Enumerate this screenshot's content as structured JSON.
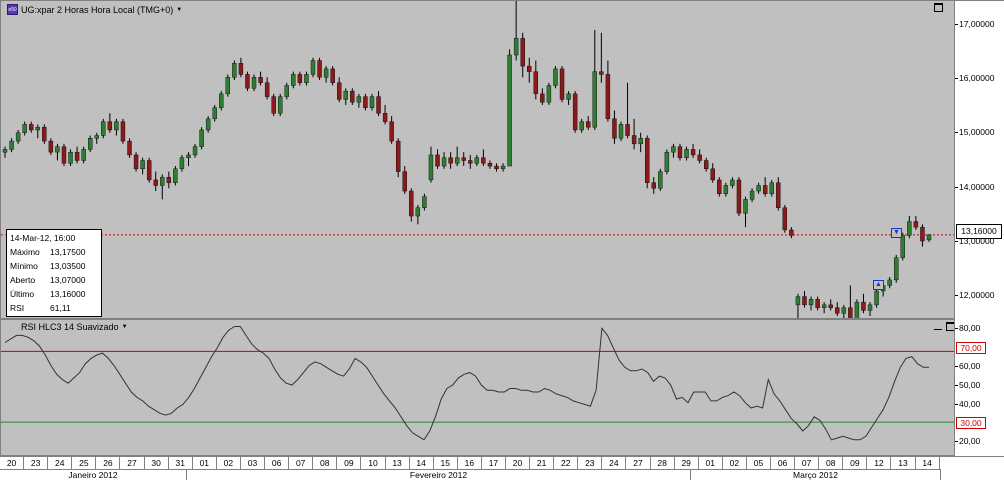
{
  "chart": {
    "title": "UG:xpar 2 Horas Hora Local (TMG+0)",
    "logo_text": "e50",
    "last_price_label": "13,16000",
    "colors": {
      "up": "#2e7d32",
      "down": "#8b1a1a",
      "wick": "#000000",
      "last_line": "#cc0000",
      "rsi_line": "#333333",
      "overbought_line": "#cc0000",
      "oversold_line": "#228b22"
    }
  },
  "info_box": {
    "header": "14-Mar-12, 16:00",
    "rows": [
      {
        "key": "Máximo",
        "value": "13,17500"
      },
      {
        "key": "Mínimo",
        "value": "13,03500"
      },
      {
        "key": "Aberto",
        "value": "13,07000"
      },
      {
        "key": "Último",
        "value": "13,16000"
      },
      {
        "key": "RSI",
        "value": "61,11"
      }
    ]
  },
  "price_axis": {
    "ticks": [
      "17,00000",
      "16,00000",
      "15,00000",
      "14,00000",
      "13,00000",
      "12,00000"
    ]
  },
  "rsi_pane": {
    "title": "RSI HLC3  14 Suavizado",
    "ticks": [
      "80,00",
      "70,00",
      "60,00",
      "50,00",
      "40,00",
      "30,00",
      "20,00"
    ],
    "overbought": "70,00",
    "oversold": "30,00"
  },
  "date_axis": {
    "days": [
      "20",
      "23",
      "24",
      "25",
      "26",
      "27",
      "30",
      "31",
      "01",
      "02",
      "03",
      "06",
      "07",
      "08",
      "09",
      "10",
      "13",
      "14",
      "15",
      "16",
      "17",
      "20",
      "21",
      "22",
      "23",
      "24",
      "27",
      "28",
      "29",
      "01",
      "02",
      "05",
      "06",
      "07",
      "08",
      "09",
      "12",
      "13",
      "14"
    ],
    "months": [
      "Janeiro 2012",
      "Fevereiro 2012",
      "Março 2012"
    ]
  },
  "chart_data": {
    "type": "candlestick",
    "y_range": [
      11.7,
      17.3
    ],
    "candles": [
      [
        14.65,
        14.75,
        14.55,
        14.7
      ],
      [
        14.7,
        14.9,
        14.65,
        14.85
      ],
      [
        14.85,
        15.05,
        14.8,
        15.0
      ],
      [
        15.0,
        15.2,
        14.95,
        15.15
      ],
      [
        15.15,
        15.2,
        15.0,
        15.05
      ],
      [
        15.05,
        15.15,
        14.9,
        15.1
      ],
      [
        15.1,
        15.15,
        14.8,
        14.85
      ],
      [
        14.85,
        14.9,
        14.6,
        14.65
      ],
      [
        14.65,
        14.8,
        14.5,
        14.75
      ],
      [
        14.75,
        14.8,
        14.4,
        14.45
      ],
      [
        14.45,
        14.7,
        14.4,
        14.65
      ],
      [
        14.65,
        14.75,
        14.45,
        14.5
      ],
      [
        14.5,
        14.75,
        14.45,
        14.7
      ],
      [
        14.7,
        14.95,
        14.65,
        14.9
      ],
      [
        14.9,
        15.0,
        14.8,
        14.95
      ],
      [
        14.95,
        15.25,
        14.9,
        15.2
      ],
      [
        15.2,
        15.35,
        15.0,
        15.05
      ],
      [
        15.05,
        15.25,
        14.95,
        15.2
      ],
      [
        15.2,
        15.25,
        14.8,
        14.85
      ],
      [
        14.85,
        14.9,
        14.55,
        14.6
      ],
      [
        14.6,
        14.65,
        14.3,
        14.35
      ],
      [
        14.35,
        14.55,
        14.25,
        14.5
      ],
      [
        14.5,
        14.55,
        14.1,
        14.15
      ],
      [
        14.15,
        14.3,
        13.95,
        14.05
      ],
      [
        14.05,
        14.25,
        13.8,
        14.2
      ],
      [
        14.2,
        14.3,
        14.0,
        14.1
      ],
      [
        14.1,
        14.4,
        14.05,
        14.35
      ],
      [
        14.35,
        14.6,
        14.3,
        14.55
      ],
      [
        14.55,
        14.65,
        14.4,
        14.6
      ],
      [
        14.6,
        14.8,
        14.55,
        14.75
      ],
      [
        14.75,
        15.1,
        14.7,
        15.05
      ],
      [
        15.05,
        15.3,
        15.0,
        15.25
      ],
      [
        15.25,
        15.5,
        15.2,
        15.45
      ],
      [
        15.45,
        15.75,
        15.4,
        15.7
      ],
      [
        15.7,
        16.05,
        15.65,
        16.0
      ],
      [
        16.0,
        16.3,
        15.95,
        16.25
      ],
      [
        16.25,
        16.35,
        16.0,
        16.05
      ],
      [
        16.05,
        16.1,
        15.75,
        15.8
      ],
      [
        15.8,
        16.05,
        15.75,
        16.0
      ],
      [
        16.0,
        16.1,
        15.85,
        15.9
      ],
      [
        15.9,
        16.0,
        15.6,
        15.65
      ],
      [
        15.65,
        15.7,
        15.3,
        15.35
      ],
      [
        15.35,
        15.7,
        15.3,
        15.65
      ],
      [
        15.65,
        15.9,
        15.6,
        15.85
      ],
      [
        15.85,
        16.1,
        15.8,
        16.05
      ],
      [
        16.05,
        16.1,
        15.85,
        15.9
      ],
      [
        15.9,
        16.1,
        15.85,
        16.05
      ],
      [
        16.05,
        16.35,
        16.0,
        16.3
      ],
      [
        16.3,
        16.35,
        15.95,
        16.0
      ],
      [
        16.0,
        16.2,
        15.9,
        16.15
      ],
      [
        16.15,
        16.2,
        15.85,
        15.9
      ],
      [
        15.9,
        16.0,
        15.55,
        15.6
      ],
      [
        15.6,
        15.8,
        15.5,
        15.75
      ],
      [
        15.75,
        15.8,
        15.5,
        15.55
      ],
      [
        15.55,
        15.7,
        15.45,
        15.65
      ],
      [
        15.65,
        15.7,
        15.4,
        15.45
      ],
      [
        15.45,
        15.7,
        15.4,
        15.65
      ],
      [
        15.65,
        15.75,
        15.3,
        15.35
      ],
      [
        15.35,
        15.5,
        15.15,
        15.2
      ],
      [
        15.2,
        15.3,
        14.8,
        14.85
      ],
      [
        14.85,
        14.9,
        14.2,
        14.3
      ],
      [
        14.3,
        14.4,
        13.9,
        13.95
      ],
      [
        13.95,
        14.0,
        13.4,
        13.5
      ],
      [
        13.5,
        13.7,
        13.35,
        13.65
      ],
      [
        13.65,
        13.9,
        13.6,
        13.85
      ],
      [
        14.15,
        14.75,
        14.1,
        14.6
      ],
      [
        14.6,
        14.7,
        14.35,
        14.4
      ],
      [
        14.4,
        14.65,
        14.35,
        14.55
      ],
      [
        14.55,
        14.65,
        14.35,
        14.45
      ],
      [
        14.45,
        14.75,
        14.4,
        14.55
      ],
      [
        14.55,
        14.65,
        14.4,
        14.5
      ],
      [
        14.5,
        14.6,
        14.35,
        14.45
      ],
      [
        14.45,
        14.6,
        14.4,
        14.55
      ],
      [
        14.55,
        14.7,
        14.4,
        14.45
      ],
      [
        14.45,
        14.5,
        14.35,
        14.4
      ],
      [
        14.4,
        14.45,
        14.3,
        14.35
      ],
      [
        14.35,
        14.45,
        14.3,
        14.4
      ],
      [
        14.4,
        16.5,
        15.3,
        16.4
      ],
      [
        16.4,
        17.4,
        16.3,
        16.7
      ],
      [
        16.7,
        16.8,
        16.0,
        16.2
      ],
      [
        16.2,
        16.35,
        15.9,
        16.1
      ],
      [
        16.1,
        16.3,
        15.6,
        15.7
      ],
      [
        15.7,
        15.8,
        15.5,
        15.55
      ],
      [
        15.55,
        15.9,
        15.5,
        15.85
      ],
      [
        15.85,
        16.2,
        15.8,
        16.15
      ],
      [
        16.15,
        16.2,
        15.55,
        15.6
      ],
      [
        15.6,
        15.75,
        15.5,
        15.7
      ],
      [
        15.7,
        15.75,
        15.0,
        15.05
      ],
      [
        15.05,
        15.25,
        15.0,
        15.2
      ],
      [
        15.2,
        15.3,
        15.05,
        15.1
      ],
      [
        15.1,
        16.85,
        15.05,
        16.1
      ],
      [
        16.1,
        16.8,
        15.9,
        16.05
      ],
      [
        16.05,
        16.3,
        15.2,
        15.25
      ],
      [
        15.25,
        15.4,
        14.8,
        14.9
      ],
      [
        14.9,
        15.2,
        14.85,
        15.15
      ],
      [
        15.15,
        15.9,
        14.9,
        14.95
      ],
      [
        14.95,
        15.25,
        14.7,
        14.8
      ],
      [
        14.8,
        15.0,
        14.65,
        14.9
      ],
      [
        14.9,
        14.95,
        14.0,
        14.1
      ],
      [
        14.1,
        14.2,
        13.9,
        14.0
      ],
      [
        14.0,
        14.35,
        13.95,
        14.3
      ],
      [
        14.3,
        14.7,
        14.25,
        14.65
      ],
      [
        14.65,
        14.8,
        14.55,
        14.75
      ],
      [
        14.75,
        14.8,
        14.5,
        14.55
      ],
      [
        14.55,
        14.75,
        14.5,
        14.7
      ],
      [
        14.7,
        14.8,
        14.55,
        14.6
      ],
      [
        14.6,
        14.7,
        14.45,
        14.5
      ],
      [
        14.5,
        14.55,
        14.3,
        14.35
      ],
      [
        14.35,
        14.45,
        14.1,
        14.15
      ],
      [
        14.15,
        14.2,
        13.85,
        13.9
      ],
      [
        13.9,
        14.1,
        13.85,
        14.05
      ],
      [
        14.05,
        14.2,
        14.0,
        14.15
      ],
      [
        14.15,
        14.2,
        13.5,
        13.55
      ],
      [
        13.55,
        13.85,
        13.3,
        13.8
      ],
      [
        13.8,
        14.0,
        13.75,
        13.95
      ],
      [
        13.95,
        14.1,
        13.9,
        14.05
      ],
      [
        14.05,
        14.2,
        13.85,
        13.9
      ],
      [
        13.9,
        14.15,
        13.85,
        14.1
      ],
      [
        14.1,
        14.2,
        13.6,
        13.65
      ],
      [
        13.65,
        13.7,
        13.2,
        13.25
      ],
      [
        13.25,
        13.3,
        13.1,
        13.15
      ],
      [
        11.9,
        12.1,
        11.6,
        12.05
      ],
      [
        12.05,
        12.15,
        11.85,
        11.9
      ],
      [
        11.9,
        12.05,
        11.8,
        12.0
      ],
      [
        12.0,
        12.05,
        11.8,
        11.85
      ],
      [
        11.85,
        11.95,
        11.75,
        11.9
      ],
      [
        11.9,
        12.0,
        11.8,
        11.85
      ],
      [
        11.85,
        11.95,
        11.7,
        11.75
      ],
      [
        11.75,
        11.9,
        11.65,
        11.85
      ],
      [
        11.85,
        12.25,
        11.55,
        11.6
      ],
      [
        11.6,
        12.0,
        11.5,
        11.95
      ],
      [
        11.95,
        12.1,
        11.75,
        11.8
      ],
      [
        11.8,
        11.95,
        11.7,
        11.9
      ],
      [
        11.9,
        12.2,
        11.85,
        12.15
      ],
      [
        12.15,
        12.3,
        12.05,
        12.25
      ],
      [
        12.25,
        12.4,
        12.2,
        12.35
      ],
      [
        12.35,
        12.8,
        12.3,
        12.75
      ],
      [
        12.75,
        13.2,
        12.7,
        13.15
      ],
      [
        13.15,
        13.5,
        13.1,
        13.4
      ],
      [
        13.4,
        13.5,
        13.25,
        13.3
      ],
      [
        13.3,
        13.35,
        12.95,
        13.05
      ],
      [
        13.07,
        13.175,
        13.035,
        13.16
      ]
    ],
    "last": 13.16,
    "rsi": [
      75,
      77,
      79,
      79,
      78,
      76,
      73,
      68,
      62,
      57,
      54,
      52,
      55,
      58,
      63,
      66,
      68,
      69,
      66,
      62,
      57,
      52,
      47,
      44,
      42,
      39,
      37,
      35,
      34,
      35,
      38,
      40,
      44,
      49,
      55,
      61,
      67,
      72,
      78,
      82,
      84,
      84,
      79,
      74,
      71,
      69,
      66,
      60,
      55,
      52,
      51,
      54,
      58,
      62,
      64,
      63,
      61,
      59,
      57,
      56,
      60,
      66,
      64,
      61,
      56,
      51,
      46,
      42,
      38,
      33,
      28,
      24,
      22,
      20,
      25,
      33,
      43,
      49,
      51,
      55,
      57,
      58,
      56,
      51,
      48,
      48,
      47,
      47,
      49,
      49,
      48,
      48,
      47,
      47,
      49,
      48,
      46,
      45,
      44,
      42,
      41,
      40,
      39,
      48,
      83,
      79,
      72,
      65,
      61,
      59,
      59,
      60,
      58,
      53,
      56,
      55,
      51,
      43,
      44,
      41,
      47,
      47,
      47,
      42,
      42,
      44,
      45,
      47,
      45,
      41,
      38,
      39,
      38,
      54,
      46,
      42,
      37,
      32,
      29,
      25,
      28,
      33,
      31,
      26,
      20,
      21,
      22,
      21,
      20,
      20,
      22,
      27,
      32,
      37,
      44,
      53,
      61,
      66,
      67,
      63,
      61,
      61
    ],
    "rsi_range": [
      12,
      86
    ],
    "overbought": 70,
    "oversold": 30
  }
}
